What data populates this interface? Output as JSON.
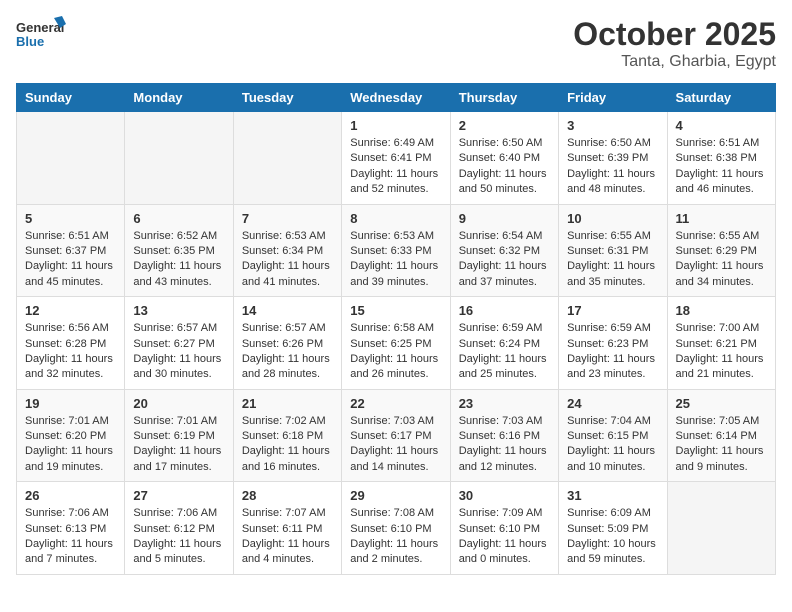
{
  "header": {
    "logo_general": "General",
    "logo_blue": "Blue",
    "month": "October 2025",
    "location": "Tanta, Gharbia, Egypt"
  },
  "weekdays": [
    "Sunday",
    "Monday",
    "Tuesday",
    "Wednesday",
    "Thursday",
    "Friday",
    "Saturday"
  ],
  "weeks": [
    [
      {
        "day": "",
        "info": ""
      },
      {
        "day": "",
        "info": ""
      },
      {
        "day": "",
        "info": ""
      },
      {
        "day": "1",
        "info": "Sunrise: 6:49 AM\nSunset: 6:41 PM\nDaylight: 11 hours\nand 52 minutes."
      },
      {
        "day": "2",
        "info": "Sunrise: 6:50 AM\nSunset: 6:40 PM\nDaylight: 11 hours\nand 50 minutes."
      },
      {
        "day": "3",
        "info": "Sunrise: 6:50 AM\nSunset: 6:39 PM\nDaylight: 11 hours\nand 48 minutes."
      },
      {
        "day": "4",
        "info": "Sunrise: 6:51 AM\nSunset: 6:38 PM\nDaylight: 11 hours\nand 46 minutes."
      }
    ],
    [
      {
        "day": "5",
        "info": "Sunrise: 6:51 AM\nSunset: 6:37 PM\nDaylight: 11 hours\nand 45 minutes."
      },
      {
        "day": "6",
        "info": "Sunrise: 6:52 AM\nSunset: 6:35 PM\nDaylight: 11 hours\nand 43 minutes."
      },
      {
        "day": "7",
        "info": "Sunrise: 6:53 AM\nSunset: 6:34 PM\nDaylight: 11 hours\nand 41 minutes."
      },
      {
        "day": "8",
        "info": "Sunrise: 6:53 AM\nSunset: 6:33 PM\nDaylight: 11 hours\nand 39 minutes."
      },
      {
        "day": "9",
        "info": "Sunrise: 6:54 AM\nSunset: 6:32 PM\nDaylight: 11 hours\nand 37 minutes."
      },
      {
        "day": "10",
        "info": "Sunrise: 6:55 AM\nSunset: 6:31 PM\nDaylight: 11 hours\nand 35 minutes."
      },
      {
        "day": "11",
        "info": "Sunrise: 6:55 AM\nSunset: 6:29 PM\nDaylight: 11 hours\nand 34 minutes."
      }
    ],
    [
      {
        "day": "12",
        "info": "Sunrise: 6:56 AM\nSunset: 6:28 PM\nDaylight: 11 hours\nand 32 minutes."
      },
      {
        "day": "13",
        "info": "Sunrise: 6:57 AM\nSunset: 6:27 PM\nDaylight: 11 hours\nand 30 minutes."
      },
      {
        "day": "14",
        "info": "Sunrise: 6:57 AM\nSunset: 6:26 PM\nDaylight: 11 hours\nand 28 minutes."
      },
      {
        "day": "15",
        "info": "Sunrise: 6:58 AM\nSunset: 6:25 PM\nDaylight: 11 hours\nand 26 minutes."
      },
      {
        "day": "16",
        "info": "Sunrise: 6:59 AM\nSunset: 6:24 PM\nDaylight: 11 hours\nand 25 minutes."
      },
      {
        "day": "17",
        "info": "Sunrise: 6:59 AM\nSunset: 6:23 PM\nDaylight: 11 hours\nand 23 minutes."
      },
      {
        "day": "18",
        "info": "Sunrise: 7:00 AM\nSunset: 6:21 PM\nDaylight: 11 hours\nand 21 minutes."
      }
    ],
    [
      {
        "day": "19",
        "info": "Sunrise: 7:01 AM\nSunset: 6:20 PM\nDaylight: 11 hours\nand 19 minutes."
      },
      {
        "day": "20",
        "info": "Sunrise: 7:01 AM\nSunset: 6:19 PM\nDaylight: 11 hours\nand 17 minutes."
      },
      {
        "day": "21",
        "info": "Sunrise: 7:02 AM\nSunset: 6:18 PM\nDaylight: 11 hours\nand 16 minutes."
      },
      {
        "day": "22",
        "info": "Sunrise: 7:03 AM\nSunset: 6:17 PM\nDaylight: 11 hours\nand 14 minutes."
      },
      {
        "day": "23",
        "info": "Sunrise: 7:03 AM\nSunset: 6:16 PM\nDaylight: 11 hours\nand 12 minutes."
      },
      {
        "day": "24",
        "info": "Sunrise: 7:04 AM\nSunset: 6:15 PM\nDaylight: 11 hours\nand 10 minutes."
      },
      {
        "day": "25",
        "info": "Sunrise: 7:05 AM\nSunset: 6:14 PM\nDaylight: 11 hours\nand 9 minutes."
      }
    ],
    [
      {
        "day": "26",
        "info": "Sunrise: 7:06 AM\nSunset: 6:13 PM\nDaylight: 11 hours\nand 7 minutes."
      },
      {
        "day": "27",
        "info": "Sunrise: 7:06 AM\nSunset: 6:12 PM\nDaylight: 11 hours\nand 5 minutes."
      },
      {
        "day": "28",
        "info": "Sunrise: 7:07 AM\nSunset: 6:11 PM\nDaylight: 11 hours\nand 4 minutes."
      },
      {
        "day": "29",
        "info": "Sunrise: 7:08 AM\nSunset: 6:10 PM\nDaylight: 11 hours\nand 2 minutes."
      },
      {
        "day": "30",
        "info": "Sunrise: 7:09 AM\nSunset: 6:10 PM\nDaylight: 11 hours\nand 0 minutes."
      },
      {
        "day": "31",
        "info": "Sunrise: 6:09 AM\nSunset: 5:09 PM\nDaylight: 10 hours\nand 59 minutes."
      },
      {
        "day": "",
        "info": ""
      }
    ]
  ]
}
